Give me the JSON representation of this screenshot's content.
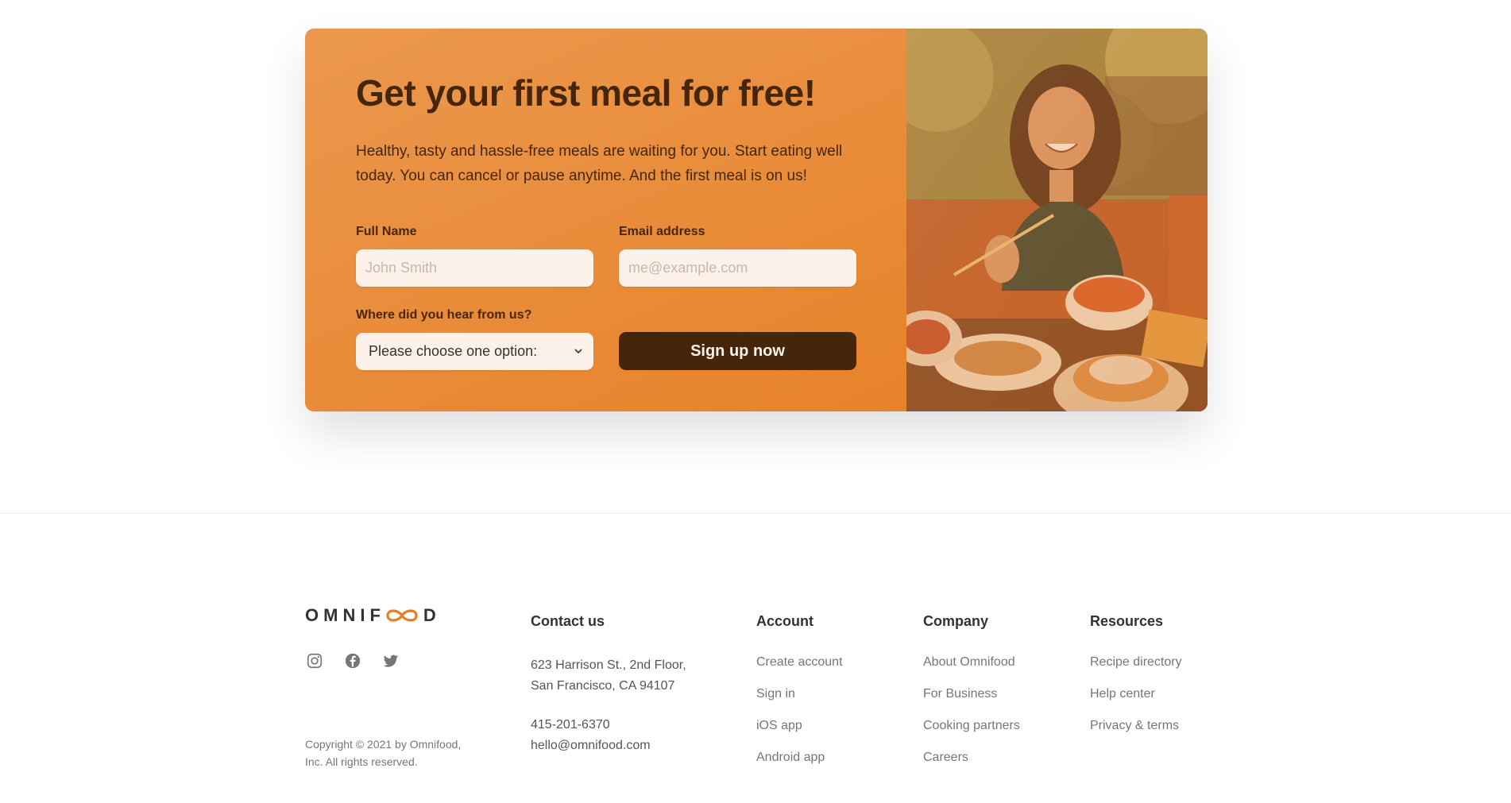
{
  "cta": {
    "title": "Get your first meal for free!",
    "description": "Healthy, tasty and hassle-free meals are waiting for you. Start eating well today. You can cancel or pause anytime. And the first meal is on us!",
    "form": {
      "full_name_label": "Full Name",
      "full_name_placeholder": "John Smith",
      "email_label": "Email address",
      "email_placeholder": "me@example.com",
      "source_label": "Where did you hear from us?",
      "source_selected": "Please choose one option:",
      "submit_label": "Sign up now"
    },
    "image_alt": "Woman enjoying food, meals in storage container, and food bowls on a table"
  },
  "footer": {
    "logo_text": "OMNIFOOD",
    "socials": [
      "instagram-icon",
      "facebook-icon",
      "twitter-icon"
    ],
    "copyright": "Copyright © 2021 by Omnifood, Inc. All rights reserved.",
    "contact": {
      "heading": "Contact us",
      "address_line1": "623 Harrison St., 2nd Floor,",
      "address_line2": "San Francisco, CA 94107",
      "phone": "415-201-6370",
      "email": "hello@omnifood.com"
    },
    "account": {
      "heading": "Account",
      "links": [
        "Create account",
        "Sign in",
        "iOS app",
        "Android app"
      ]
    },
    "company": {
      "heading": "Company",
      "links": [
        "About Omnifood",
        "For Business",
        "Cooking partners",
        "Careers"
      ]
    },
    "resources": {
      "heading": "Resources",
      "links": [
        "Recipe directory",
        "Help center",
        "Privacy & terms"
      ]
    }
  },
  "colors": {
    "primary": "#e67e22",
    "primary_light": "#eb984e",
    "dark": "#45260a",
    "tint": "#fdf2e9"
  }
}
